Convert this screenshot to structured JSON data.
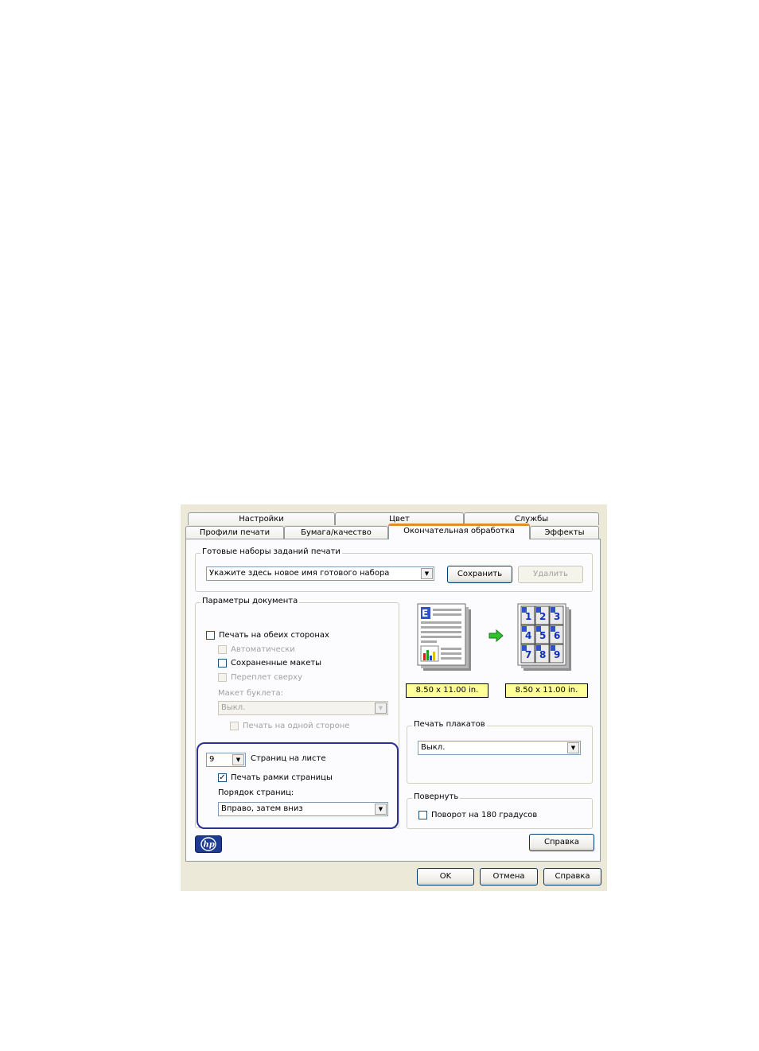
{
  "tabs_row1": [
    "Настройки",
    "Цвет",
    "Службы"
  ],
  "tabs_row2": [
    "Профили печати",
    "Бумага/качество",
    "Окончательная обработка",
    "Эффекты"
  ],
  "presets": {
    "legend": "Готовые наборы заданий печати",
    "select_value": "Укажите здесь новое имя готового набора",
    "save_label": "Сохранить",
    "delete_label": "Удалить"
  },
  "doc_params": {
    "legend": "Параметры документа",
    "duplex": "Печать на обеих сторонах",
    "auto": "Автоматически",
    "saved_layouts": "Сохраненные макеты",
    "flip_top": "Переплет сверху",
    "booklet_label": "Макет буклета:",
    "booklet_value": "Выкл.",
    "one_side": "Печать на одной стороне",
    "pages_per_sheet_value": "9",
    "pages_per_sheet_label": "Страниц на листе",
    "page_borders": "Печать рамки страницы",
    "page_order_label": "Порядок страниц:",
    "page_order_value": "Вправо, затем вниз"
  },
  "preview": {
    "size_left": "8.50 x 11.00 in.",
    "size_right": "8.50 x 11.00 in.",
    "numbers": [
      "1",
      "2",
      "3",
      "4",
      "5",
      "6",
      "7",
      "8",
      "9"
    ]
  },
  "poster": {
    "legend": "Печать плакатов",
    "value": "Выкл."
  },
  "rotate": {
    "legend": "Повернуть",
    "label": "Поворот на 180 градусов"
  },
  "help_inner": "Справка",
  "footer": {
    "ok": "OK",
    "cancel": "Отмена",
    "help": "Справка"
  },
  "colors": {
    "accent": "#e68b2c",
    "highlight": "#2e3192",
    "hp_blue": "#1d3b93",
    "size_fill": "#ffff99"
  }
}
